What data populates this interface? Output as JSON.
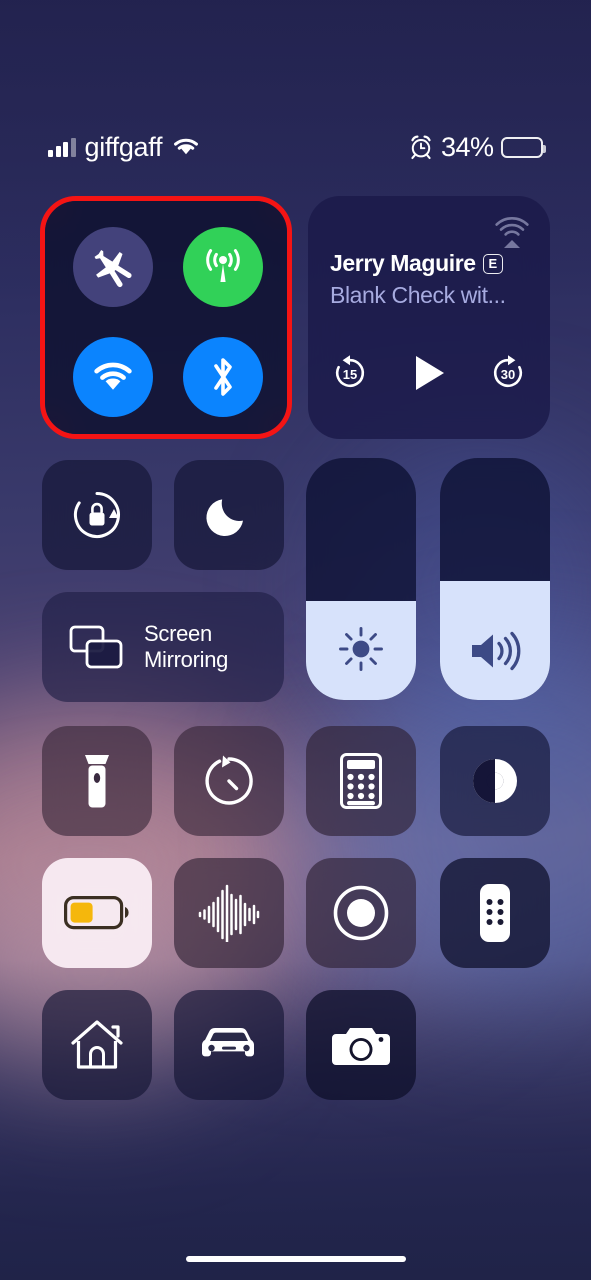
{
  "status_bar": {
    "carrier": "giffgaff",
    "signal_bars_filled": 3,
    "signal_bars_total": 4,
    "wifi_icon": "wifi-icon",
    "alarm_icon": "alarm-clock-icon",
    "battery_percent_label": "34%",
    "battery_level": 34,
    "battery_color": "#f5c518"
  },
  "colors": {
    "highlight_border": "#f41414",
    "toggle_on_green": "#31d158",
    "toggle_on_blue": "#0b84fe",
    "toggle_off": "#565496",
    "slider_fill": "#d7e2fb",
    "media_subtitle": "#a7abe0"
  },
  "connectivity": {
    "highlighted": true,
    "buttons": [
      {
        "name": "airplane-mode",
        "label": "Airplane Mode",
        "state": "off"
      },
      {
        "name": "cellular-data",
        "label": "Cellular Data",
        "state": "on"
      },
      {
        "name": "wifi",
        "label": "Wi-Fi",
        "state": "on"
      },
      {
        "name": "bluetooth",
        "label": "Bluetooth",
        "state": "on"
      }
    ]
  },
  "media": {
    "title": "Jerry Maguire",
    "explicit_badge": "E",
    "subtitle": "Blank Check wit...",
    "airplay_icon": "airplay-audio-icon",
    "controls": {
      "rewind_label": "15",
      "play_label": "play-icon",
      "forward_label": "30"
    }
  },
  "toggles": {
    "rotation_lock": {
      "label": "Rotation Lock",
      "state": "off"
    },
    "do_not_disturb": {
      "label": "Do Not Disturb",
      "state": "off"
    },
    "screen_mirroring": {
      "label_line1": "Screen",
      "label_line2": "Mirroring"
    }
  },
  "sliders": {
    "brightness": {
      "label": "Brightness",
      "value": 41
    },
    "volume": {
      "label": "Volume",
      "value": 49
    }
  },
  "utilities": [
    {
      "name": "flashlight",
      "label": "Flashlight",
      "state": "off",
      "style": "warm"
    },
    {
      "name": "timer",
      "label": "Timer",
      "state": "off",
      "style": "warm"
    },
    {
      "name": "calculator",
      "label": "Calculator",
      "state": "off",
      "style": "warm2"
    },
    {
      "name": "dark-mode",
      "label": "Dark Mode",
      "state": "off",
      "style": "dk"
    },
    {
      "name": "low-power-mode",
      "label": "Low Power Mode",
      "state": "on",
      "style": "lit"
    },
    {
      "name": "voice-memos",
      "label": "Voice Memos",
      "state": "off",
      "style": "warm2"
    },
    {
      "name": "screen-recording",
      "label": "Screen Recording",
      "state": "off",
      "style": "warm2"
    },
    {
      "name": "apple-tv-remote",
      "label": "Apple TV Remote",
      "state": "off",
      "style": "dkr"
    },
    {
      "name": "home",
      "label": "Home",
      "state": "off",
      "style": "dk"
    },
    {
      "name": "driving-focus",
      "label": "Driving Focus",
      "state": "off",
      "style": "dk"
    },
    {
      "name": "camera",
      "label": "Camera",
      "state": "off",
      "style": "dkr"
    }
  ],
  "home_indicator": "home-indicator"
}
